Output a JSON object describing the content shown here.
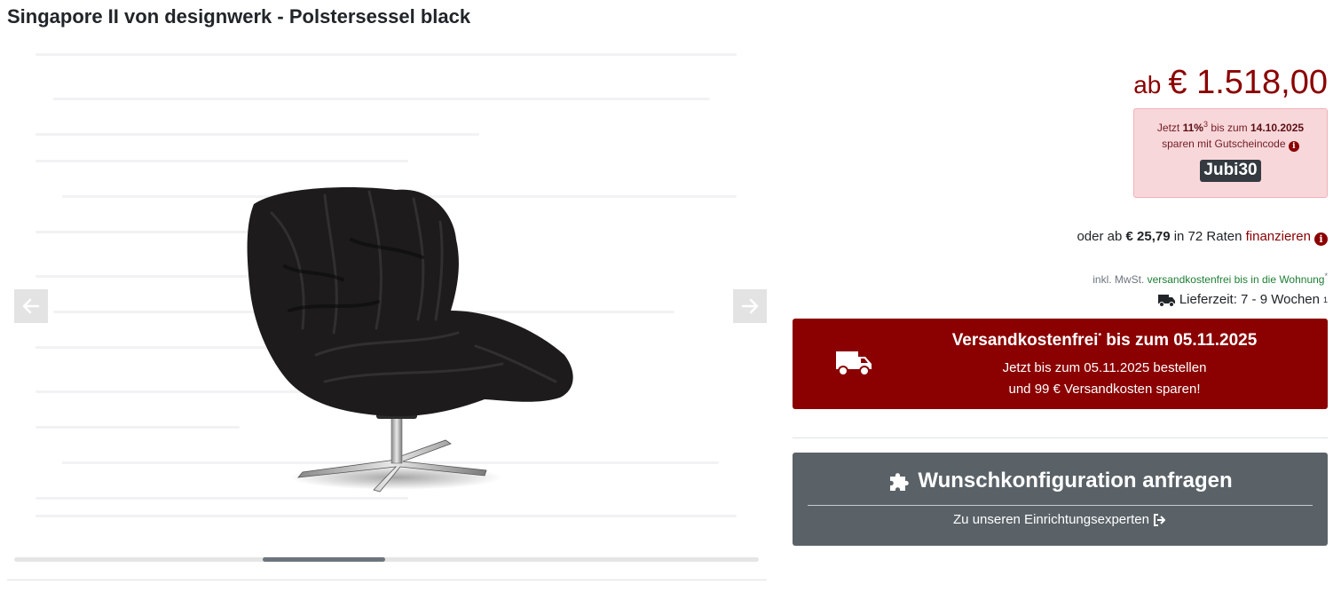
{
  "product": {
    "title": "Singapore II von designwerk - Polstersessel black"
  },
  "gallery": {
    "image_description_icon": "armchair-image",
    "prev_icon": "arrow-left-icon",
    "next_icon": "arrow-right-icon",
    "scroll_position": 0.33
  },
  "price": {
    "prefix": "ab",
    "amount": "€ 1.518,00",
    "color": "#8b0000"
  },
  "coupon": {
    "text_pre": "Jetzt ",
    "percent": "11%",
    "percent_sup": "3",
    "text_mid": " bis zum ",
    "date": "14.10.2025",
    "line2": "sparen mit Gutscheincode",
    "code": "Jubi30"
  },
  "finance": {
    "pre": "oder ab ",
    "rate": "€ 25,79",
    "mid": " in 72 Raten ",
    "link": "finanzieren"
  },
  "shipping_info": {
    "mwst": "inkl. MwSt. ",
    "free": "versandkostenfrei bis in die Wohnung",
    "free_sup": "*",
    "delivery": "Lieferzeit: 7 - 9 Wochen",
    "delivery_sup": "1"
  },
  "promo": {
    "title_a": "Versandkostenfrei",
    "title_sup": "*",
    "title_b": " bis zum 05.11.2025",
    "line1": "Jetzt bis zum 05.11.2025 bestellen",
    "line2": "und 99 € Versandkosten sparen!",
    "bg_color": "#8b0000"
  },
  "config": {
    "title": "Wunschkonfiguration anfragen",
    "subtitle": "Zu unseren Einrichtungsexperten",
    "bg_color": "#5a6268"
  }
}
